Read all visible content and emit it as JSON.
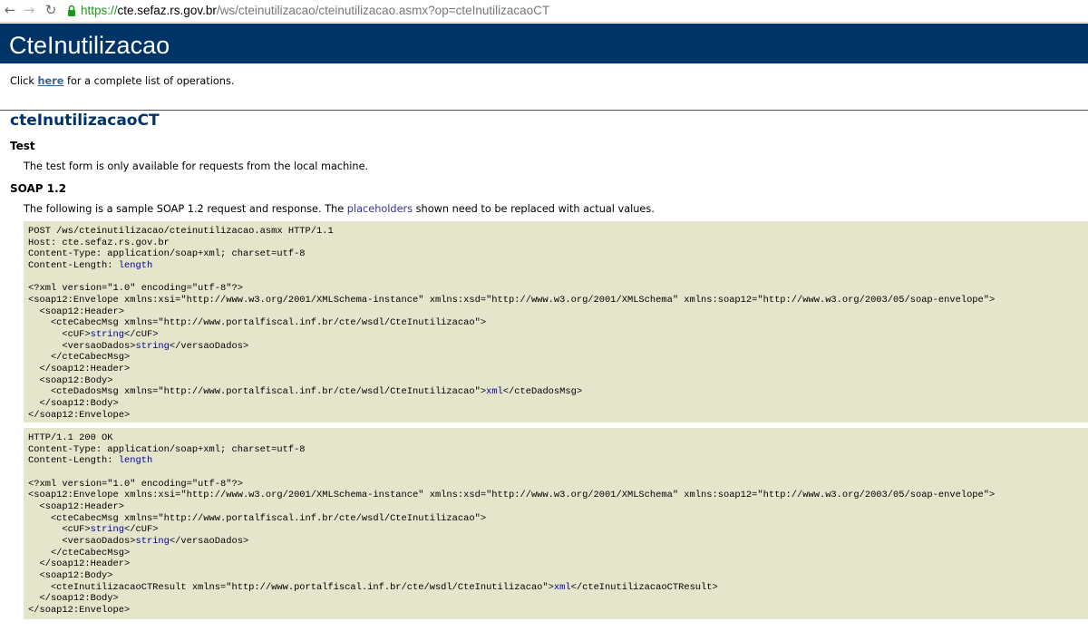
{
  "browser": {
    "back_icon": "←",
    "forward_icon": "→",
    "reload_icon": "↻",
    "url_scheme": "https://",
    "url_host": "cte.sefaz.rs.gov.br",
    "url_path": "/ws/cteinutilizacao/cteinutilizacao.asmx?op=cteInutilizacaoCT"
  },
  "page": {
    "service_title": "CteInutilizacao",
    "intro_before": "Click ",
    "intro_link": "here",
    "intro_after": " for a complete list of operations.",
    "operation_title": "cteInutilizacaoCT",
    "test_heading": "Test",
    "test_text": "The test form is only available for requests from the local machine.",
    "soap_heading": "SOAP 1.2",
    "soap_text_before": "The following is a sample SOAP 1.2 request and response.  The ",
    "soap_text_highlight": "placeholders",
    "soap_text_after": " shown need to be replaced with actual values."
  },
  "request_sample": [
    [
      "POST /ws/cteinutilizacao/cteinutilizacao.asmx HTTP/1.1"
    ],
    [
      "Host: cte.sefaz.rs.gov.br"
    ],
    [
      "Content-Type: application/soap+xml; charset=utf-8"
    ],
    [
      "Content-Length: ",
      {
        "ph": "length"
      }
    ],
    [
      ""
    ],
    [
      "<?xml version=\"1.0\" encoding=\"utf-8\"?>"
    ],
    [
      "<soap12:Envelope xmlns:xsi=\"http://www.w3.org/2001/XMLSchema-instance\" xmlns:xsd=\"http://www.w3.org/2001/XMLSchema\" xmlns:soap12=\"http://www.w3.org/2003/05/soap-envelope\">"
    ],
    [
      "  <soap12:Header>"
    ],
    [
      "    <cteCabecMsg xmlns=\"http://www.portalfiscal.inf.br/cte/wsdl/CteInutilizacao\">"
    ],
    [
      "      <cUF>",
      {
        "ph": "string"
      },
      "</cUF>"
    ],
    [
      "      <versaoDados>",
      {
        "ph": "string"
      },
      "</versaoDados>"
    ],
    [
      "    </cteCabecMsg>"
    ],
    [
      "  </soap12:Header>"
    ],
    [
      "  <soap12:Body>"
    ],
    [
      "    <cteDadosMsg xmlns=\"http://www.portalfiscal.inf.br/cte/wsdl/CteInutilizacao\">",
      {
        "ph": "xml"
      },
      "</cteDadosMsg>"
    ],
    [
      "  </soap12:Body>"
    ],
    [
      "</soap12:Envelope>"
    ]
  ],
  "response_sample": [
    [
      "HTTP/1.1 200 OK"
    ],
    [
      "Content-Type: application/soap+xml; charset=utf-8"
    ],
    [
      "Content-Length: ",
      {
        "ph": "length"
      }
    ],
    [
      ""
    ],
    [
      "<?xml version=\"1.0\" encoding=\"utf-8\"?>"
    ],
    [
      "<soap12:Envelope xmlns:xsi=\"http://www.w3.org/2001/XMLSchema-instance\" xmlns:xsd=\"http://www.w3.org/2001/XMLSchema\" xmlns:soap12=\"http://www.w3.org/2003/05/soap-envelope\">"
    ],
    [
      "  <soap12:Header>"
    ],
    [
      "    <cteCabecMsg xmlns=\"http://www.portalfiscal.inf.br/cte/wsdl/CteInutilizacao\">"
    ],
    [
      "      <cUF>",
      {
        "ph": "string"
      },
      "</cUF>"
    ],
    [
      "      <versaoDados>",
      {
        "ph": "string"
      },
      "</versaoDados>"
    ],
    [
      "    </cteCabecMsg>"
    ],
    [
      "  </soap12:Header>"
    ],
    [
      "  <soap12:Body>"
    ],
    [
      "    <cteInutilizacaoCTResult xmlns=\"http://www.portalfiscal.inf.br/cte/wsdl/CteInutilizacao\">",
      {
        "ph": "xml"
      },
      "</cteInutilizacaoCTResult>"
    ],
    [
      "  </soap12:Body>"
    ],
    [
      "</soap12:Envelope>"
    ]
  ],
  "colors": {
    "banner": "#003366",
    "link": "#336699",
    "placeholder": "#000099",
    "code_background": "#e5e5cc"
  }
}
